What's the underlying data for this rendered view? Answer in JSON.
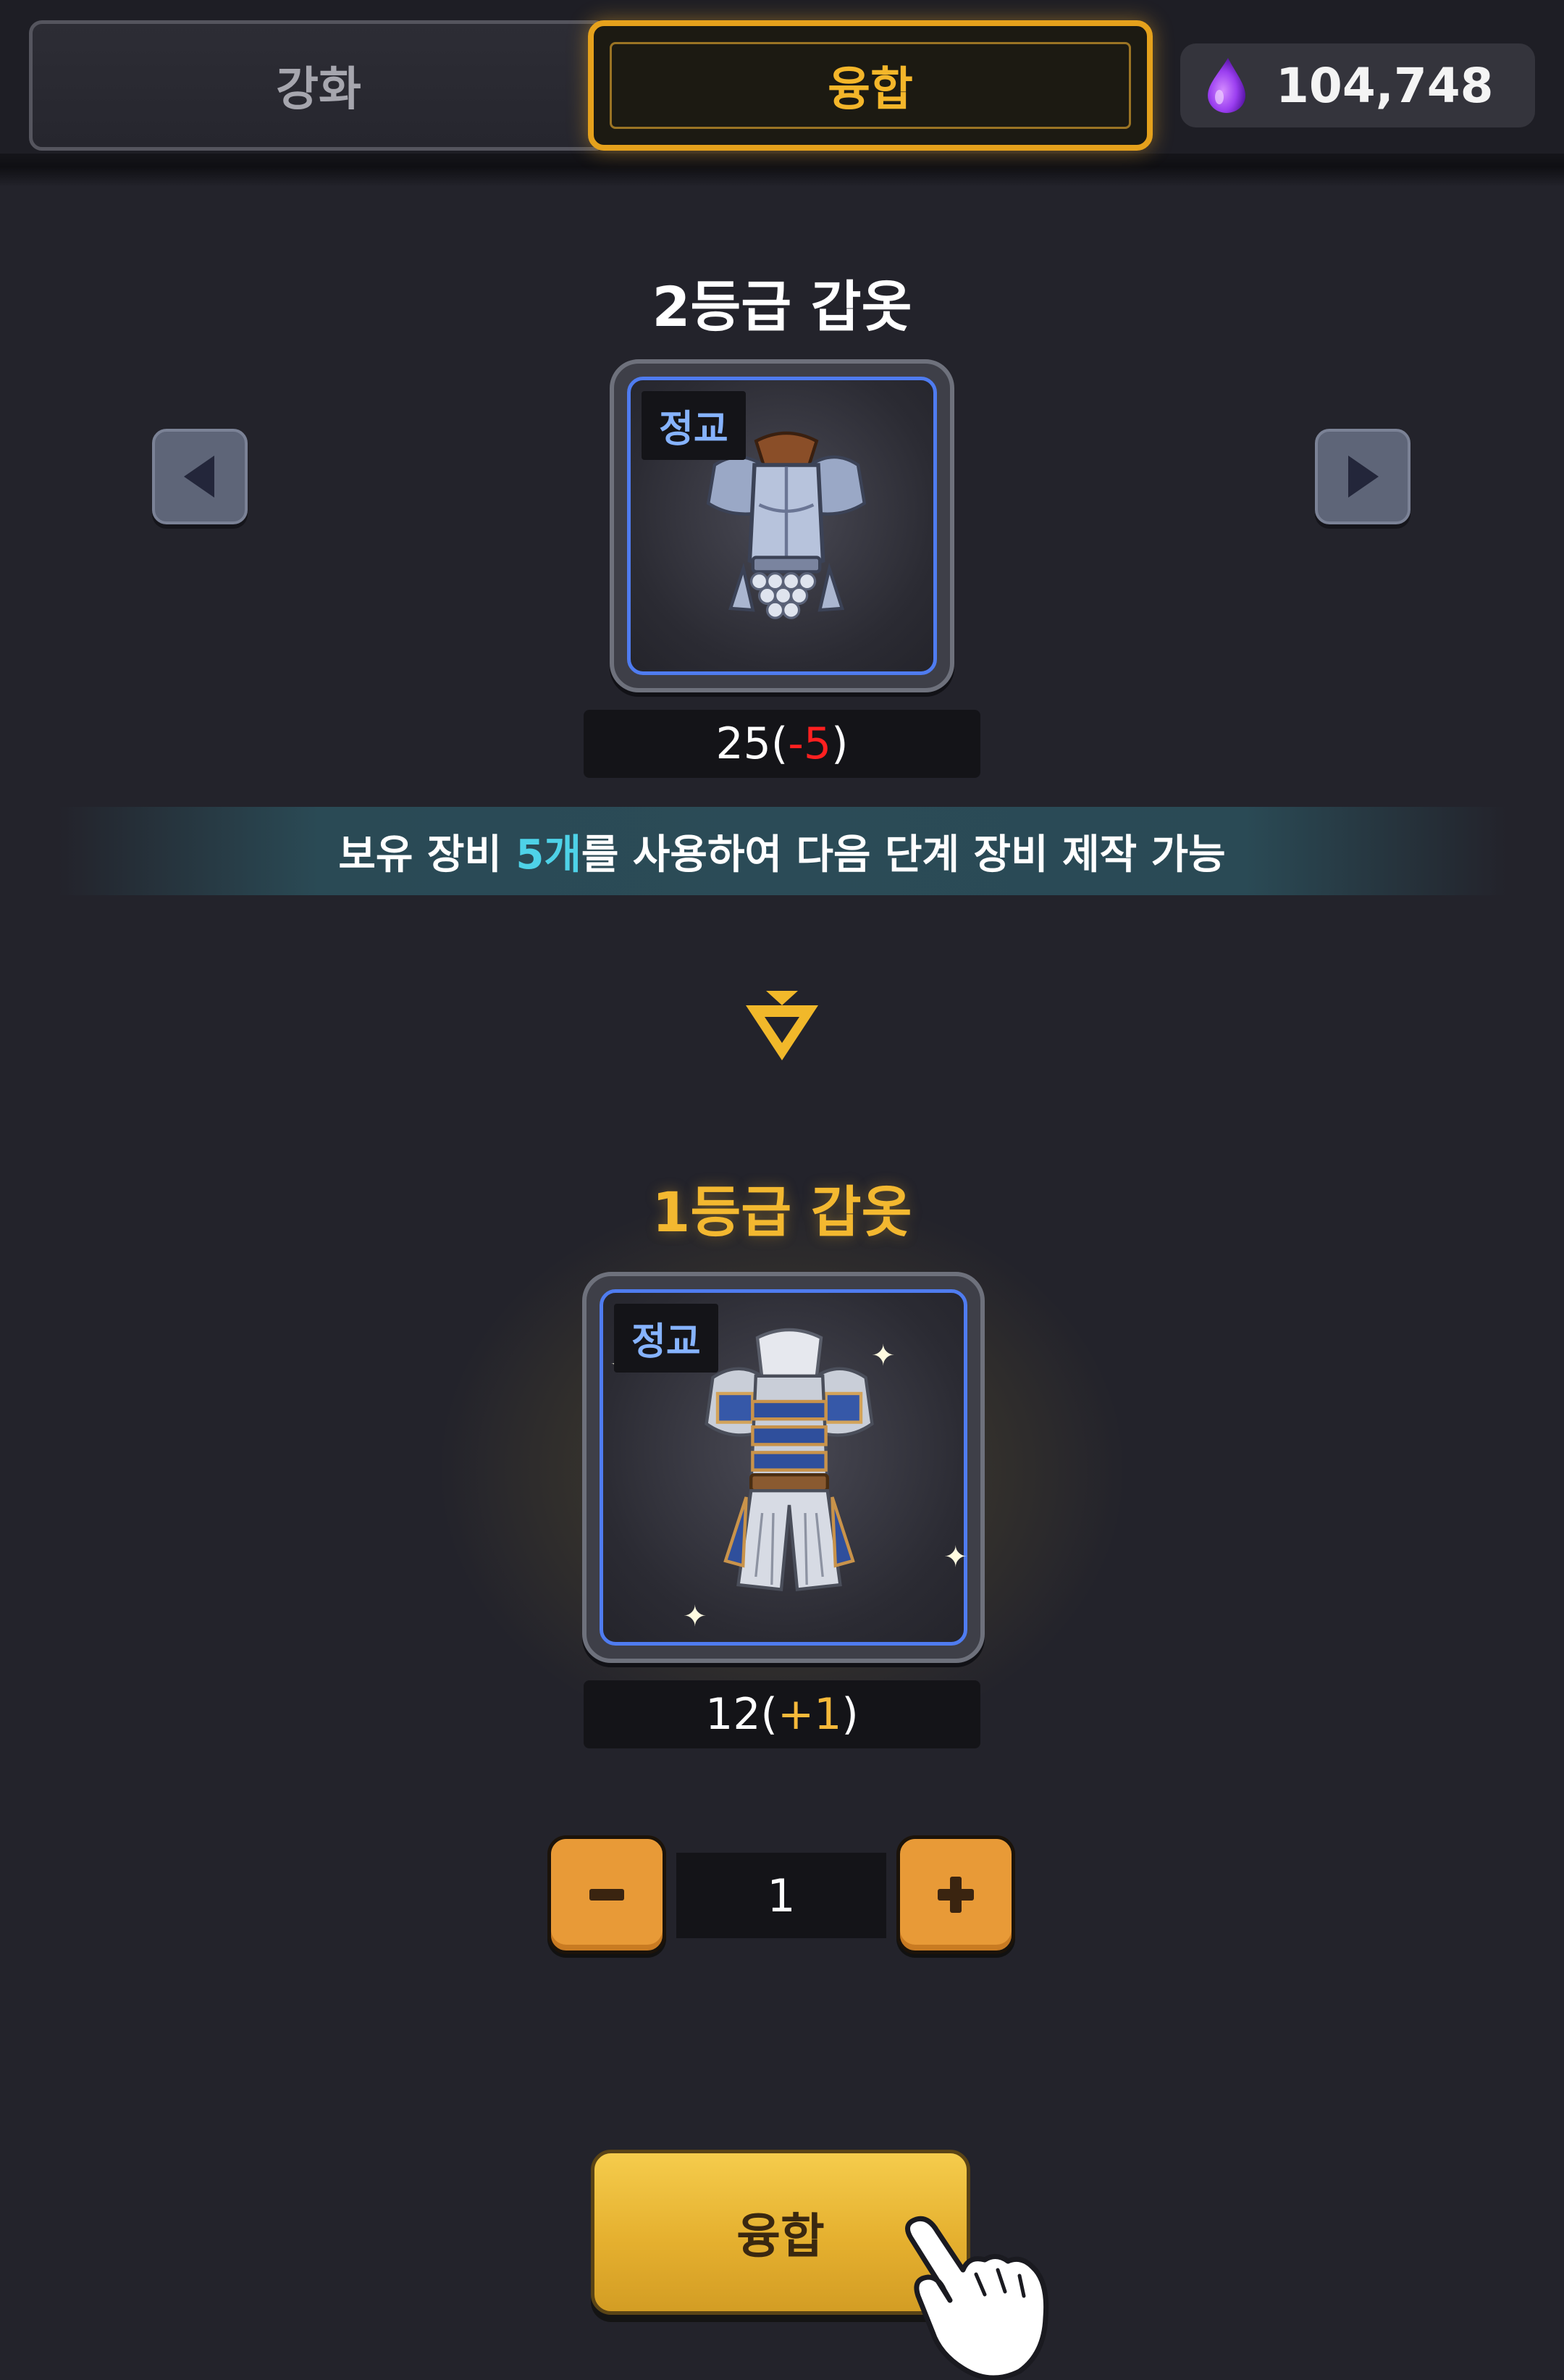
{
  "tabs": [
    {
      "label": "강화",
      "active": false
    },
    {
      "label": "융합",
      "active": true
    }
  ],
  "currency": {
    "icon": "purple-drop-icon",
    "value": "104,748"
  },
  "source_item": {
    "title": "2등급 갑옷",
    "badge": "정교",
    "count_base": "25(",
    "count_delta": "-5",
    "count_close": ")"
  },
  "info": {
    "prefix": "보유 장비 ",
    "highlight": "5개",
    "suffix": "를 사용하여 다음 단계 장비 제작 가능"
  },
  "target_item": {
    "title": "1등급 갑옷",
    "badge": "정교",
    "count_base": "12(",
    "count_delta": "+1",
    "count_close": ")"
  },
  "quantity": {
    "value": "1",
    "minus_icon": "minus-icon",
    "plus_icon": "plus-icon"
  },
  "fuse_button": {
    "label": "융합"
  },
  "colors": {
    "background": "#23232b",
    "accent_gold": "#f3b830",
    "frame_blue": "#4f7cf0",
    "negative": "#ff2020",
    "highlight_cyan": "#4ed2e8",
    "stepper_orange": "#e89a37"
  }
}
